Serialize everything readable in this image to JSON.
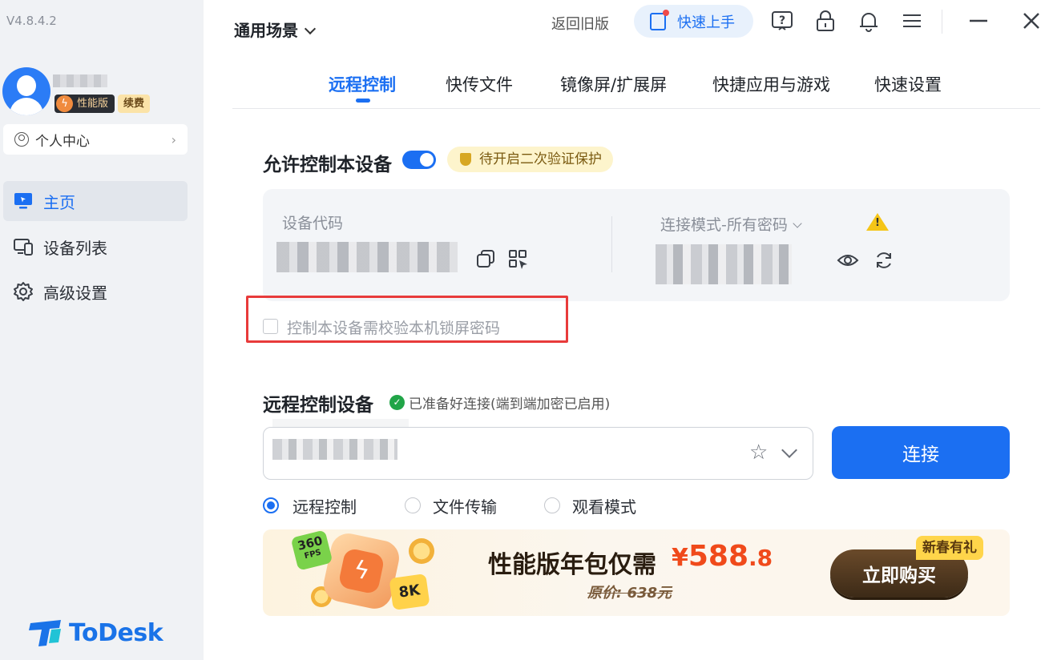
{
  "app": {
    "version": "V4.8.4.2",
    "logo_text": "ToDesk"
  },
  "user": {
    "badge_perf": "性能版",
    "badge_renew": "续费",
    "personal_center": "个人中心"
  },
  "sidebar": {
    "items": [
      {
        "label": "主页",
        "icon": "monitor-icon",
        "active": true
      },
      {
        "label": "设备列表",
        "icon": "devices-icon",
        "active": false
      },
      {
        "label": "高级设置",
        "icon": "gear-icon",
        "active": false
      }
    ]
  },
  "header": {
    "scene": "通用场景",
    "back_old": "返回旧版",
    "quick_start": "快速上手"
  },
  "tabs": [
    {
      "label": "远程控制",
      "active": true
    },
    {
      "label": "快传文件",
      "active": false
    },
    {
      "label": "镜像屏/扩展屏",
      "active": false
    },
    {
      "label": "快捷应用与游戏",
      "active": false
    },
    {
      "label": "快速设置",
      "active": false
    }
  ],
  "allow": {
    "title": "允许控制本设备",
    "toggle_on": true,
    "warning": "待开启二次验证保护",
    "device_code_label": "设备代码",
    "conn_mode": "连接模式-所有密码",
    "lock_check_label": "控制本设备需校验本机锁屏密码",
    "lock_check_checked": false
  },
  "remote": {
    "title": "远程控制设备",
    "ready": "已准备好连接(端到端加密已启用)",
    "connect": "连接",
    "modes": [
      {
        "label": "远程控制",
        "selected": true
      },
      {
        "label": "文件传输",
        "selected": false
      },
      {
        "label": "观看模式",
        "selected": false
      }
    ]
  },
  "banner": {
    "fps": "360",
    "fps_unit": "FPS",
    "res": "8K",
    "title": "性能版年包仅需",
    "price_symbol": "¥",
    "price_int": "588",
    "price_dec": ".8",
    "original": "原价: 638元",
    "buy": "立即购买",
    "tag": "新春有礼"
  },
  "colors": {
    "accent": "#1b6ff2",
    "highlight_box": "#e83b3b",
    "price": "#f04a1b"
  }
}
